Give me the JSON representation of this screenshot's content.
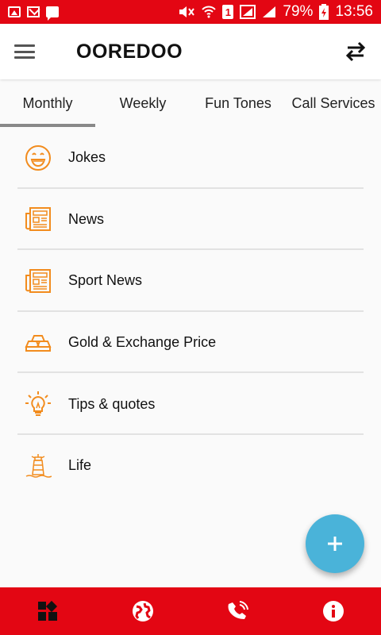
{
  "status_bar": {
    "battery": "79%",
    "time": "13:56",
    "sim": "1"
  },
  "app_bar": {
    "title": "OOREDOO"
  },
  "tabs": [
    {
      "label": "Monthly"
    },
    {
      "label": "Weekly"
    },
    {
      "label": "Fun Tones"
    },
    {
      "label": "Call Services"
    }
  ],
  "list": {
    "items": [
      {
        "label": "Jokes",
        "icon": "smiley-icon"
      },
      {
        "label": "News",
        "icon": "newspaper-icon"
      },
      {
        "label": "Sport News",
        "icon": "newspaper-icon"
      },
      {
        "label": "Gold & Exchange Price",
        "icon": "gold-bars-icon"
      },
      {
        "label": "Tips & quotes",
        "icon": "lightbulb-icon"
      },
      {
        "label": "Life",
        "icon": "lighthouse-icon"
      }
    ]
  },
  "colors": {
    "brand_red": "#e30613",
    "icon_orange": "#f28c1e",
    "fab_blue": "#4ab3d9"
  }
}
